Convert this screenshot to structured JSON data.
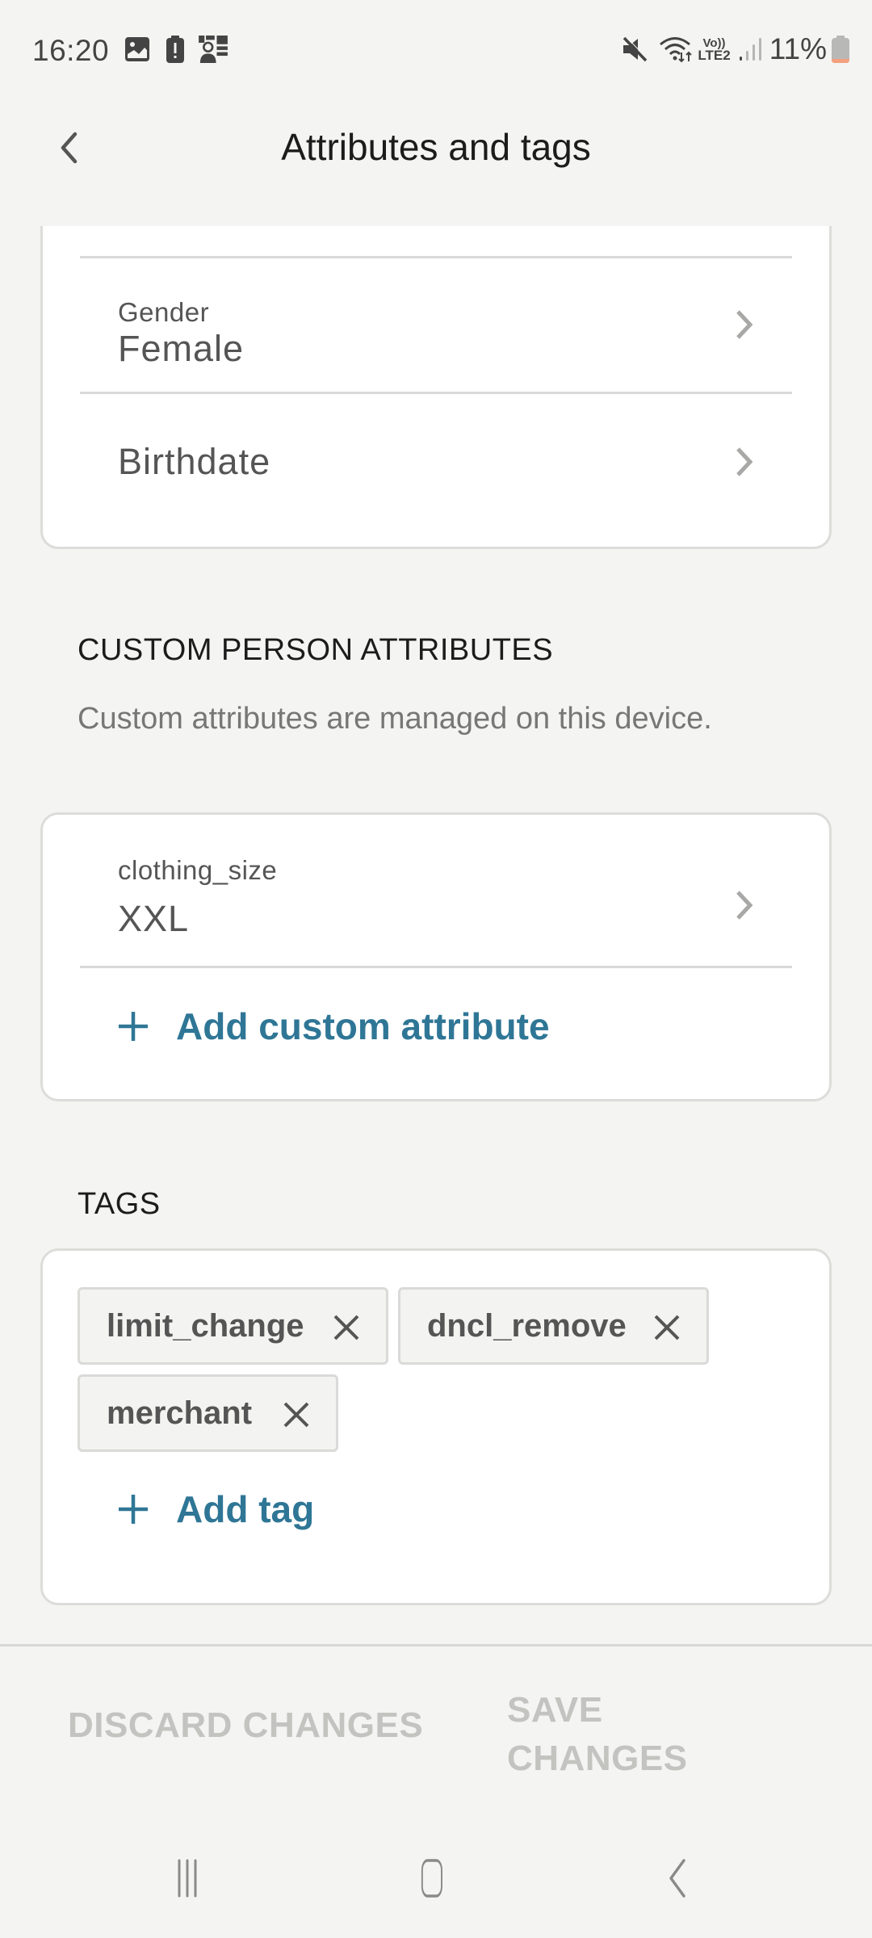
{
  "status_bar": {
    "time": "16:20",
    "left_icons": [
      "gallery-icon",
      "battery-alert-icon",
      "profile-grid-icon"
    ],
    "right_icons": [
      "mute-icon",
      "wifi-icon",
      "volte-lte2-icon",
      "signal-icon"
    ],
    "network_label_top": "Vo))",
    "network_label_bottom": "LTE2",
    "battery_percent": "11%"
  },
  "header": {
    "title": "Attributes and tags",
    "back_icon": "chevron-left-icon"
  },
  "standard_attributes": {
    "rows": [
      {
        "label": "Gender",
        "value": "Female"
      },
      {
        "label": "",
        "value": "Birthdate"
      }
    ]
  },
  "custom_attributes": {
    "title": "CUSTOM PERSON ATTRIBUTES",
    "description": "Custom attributes are managed on this device.",
    "rows": [
      {
        "label": "clothing_size",
        "value": "XXL"
      }
    ],
    "add_label": "Add custom attribute"
  },
  "tags": {
    "title": "TAGS",
    "items": [
      "limit_change",
      "dncl_remove",
      "merchant"
    ],
    "add_label": "Add tag"
  },
  "actions": {
    "discard_label": "DISCARD CHANGES",
    "save_label_line1": "SAVE",
    "save_label_line2": "CHANGES"
  },
  "nav_bar": {
    "icons": [
      "recents-icon",
      "home-icon",
      "back-icon"
    ]
  },
  "colors": {
    "accent": "#2f7696",
    "background": "#f4f4f2",
    "card": "#ffffff",
    "disabled_text": "#c3c3c0",
    "battery_low": "#f4a07e"
  }
}
